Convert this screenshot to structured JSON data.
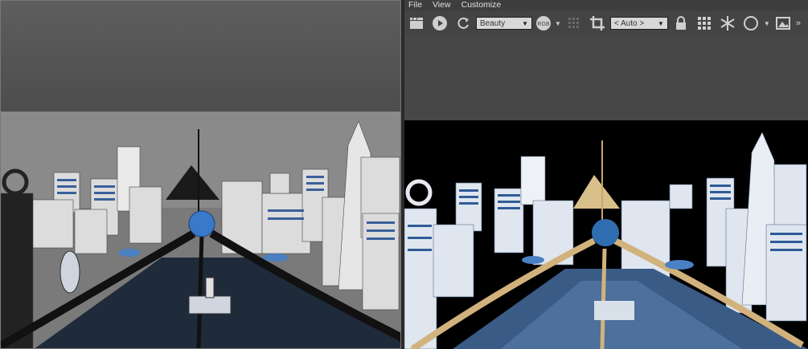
{
  "menu": {
    "items": [
      "File",
      "View",
      "Customize"
    ]
  },
  "toolbar": {
    "render_element": "Beauty",
    "channel_label": "RGB",
    "region_option": "< Auto >"
  },
  "viewport": {
    "sky_color": "#4d4d4d",
    "scene_color": "#868686"
  },
  "render": {
    "background": "#000000",
    "accent_gold": "#d8c08a",
    "accent_blue": "#2f6db0"
  }
}
